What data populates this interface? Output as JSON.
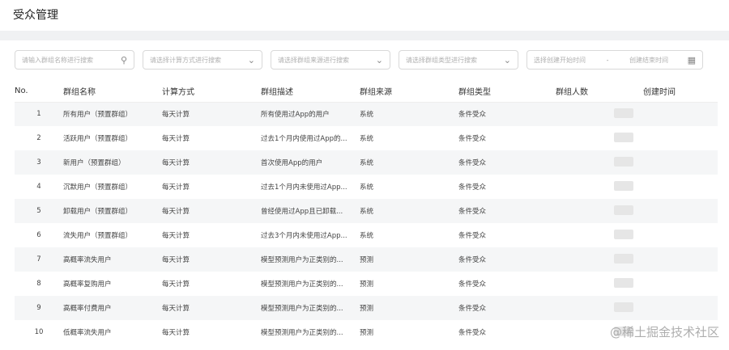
{
  "page": {
    "title": "受众管理"
  },
  "filters": {
    "name_search": {
      "placeholder": "请输入群组名称进行搜索",
      "icon": "search-icon"
    },
    "calc_method": {
      "placeholder": "请选择计算方式进行搜索",
      "icon": "chevron-down-icon"
    },
    "group_source": {
      "placeholder": "请选择群组来源进行搜索",
      "icon": "chevron-down-icon"
    },
    "group_type": {
      "placeholder": "请选择群组类型进行搜索",
      "icon": "chevron-down-icon"
    },
    "date_range": {
      "start_placeholder": "选择创建开始时间",
      "separator": "-",
      "end_placeholder": "创建结束时间",
      "icon": "calendar-icon"
    }
  },
  "table": {
    "headers": {
      "no": "No.",
      "name": "群组名称",
      "calc": "计算方式",
      "desc": "群组描述",
      "source": "群组来源",
      "type": "群组类型",
      "count": "群组人数",
      "created": "创建时间"
    },
    "rows": [
      {
        "no": "1",
        "name": "所有用户（预置群组）",
        "calc": "每天计算",
        "desc": "所有使用过App的用户",
        "source": "系统",
        "type": "条件受众"
      },
      {
        "no": "2",
        "name": "活跃用户（预置群组）",
        "calc": "每天计算",
        "desc": "过去1个月内使用过App的...",
        "source": "系统",
        "type": "条件受众"
      },
      {
        "no": "3",
        "name": "新用户（预置群组）",
        "calc": "每天计算",
        "desc": "首次使用App的用户",
        "source": "系统",
        "type": "条件受众"
      },
      {
        "no": "4",
        "name": "沉默用户（预置群组）",
        "calc": "每天计算",
        "desc": "过去1个月内未使用过App...",
        "source": "系统",
        "type": "条件受众"
      },
      {
        "no": "5",
        "name": "卸载用户（预置群组）",
        "calc": "每天计算",
        "desc": "曾经使用过App且已卸载...",
        "source": "系统",
        "type": "条件受众"
      },
      {
        "no": "6",
        "name": "流失用户（预置群组）",
        "calc": "每天计算",
        "desc": "过去3个月内未使用过App...",
        "source": "系统",
        "type": "条件受众"
      },
      {
        "no": "7",
        "name": "高概率流失用户",
        "calc": "每天计算",
        "desc": "模型预测用户为正类别的...",
        "source": "预测",
        "type": "条件受众"
      },
      {
        "no": "8",
        "name": "高概率复购用户",
        "calc": "每天计算",
        "desc": "模型预测用户为正类别的...",
        "source": "预测",
        "type": "条件受众"
      },
      {
        "no": "9",
        "name": "高概率付费用户",
        "calc": "每天计算",
        "desc": "模型预测用户为正类别的...",
        "source": "预测",
        "type": "条件受众"
      },
      {
        "no": "10",
        "name": "低概率流失用户",
        "calc": "每天计算",
        "desc": "模型预测用户为正类别的...",
        "source": "预测",
        "type": "条件受众"
      }
    ]
  },
  "watermark": "@稀土掘金技术社区"
}
